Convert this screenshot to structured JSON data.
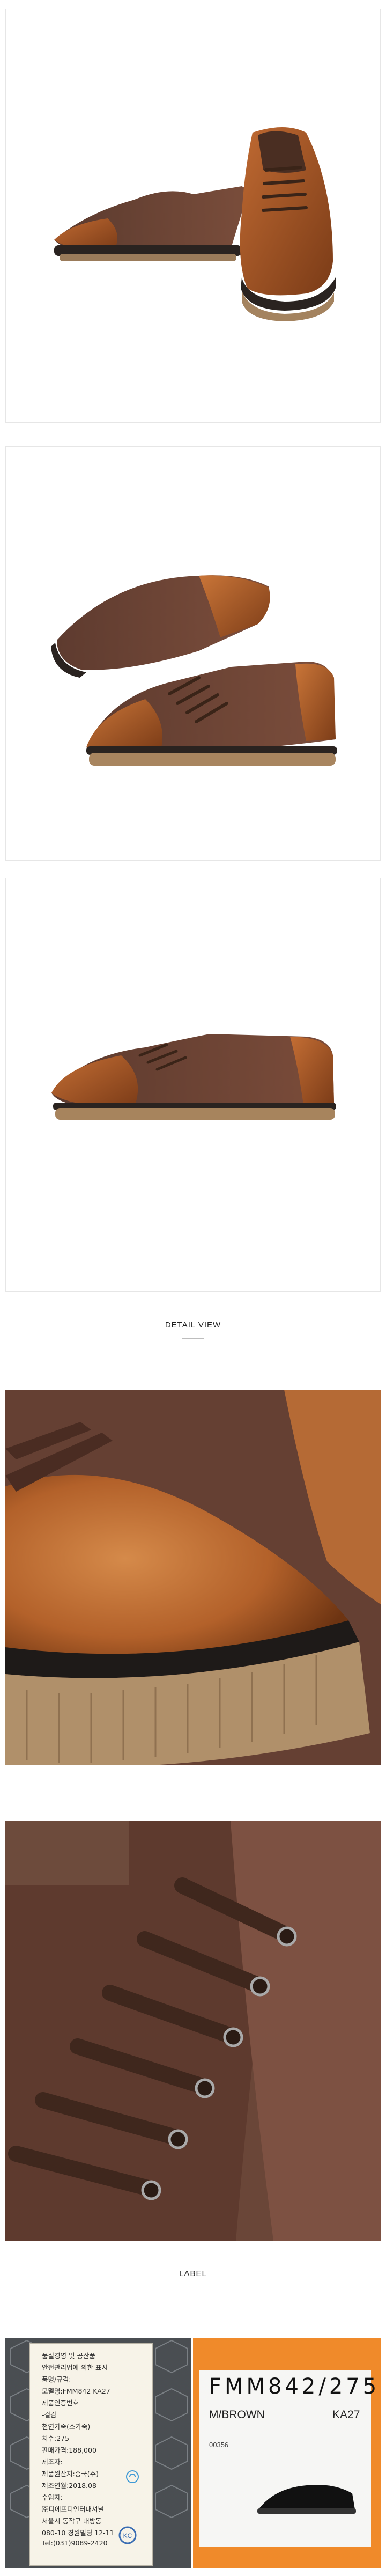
{
  "sections": {
    "detail_view": "DETAIL VIEW",
    "label": "LABEL"
  },
  "product_label": {
    "lines": [
      "품질경영 및 공산품",
      "안전관리법에 의한 표시",
      "품명/규격:",
      "모델명:FMM842 KA27",
      "제품인증번호",
      "-겉감",
      "    천연가죽(소가죽)",
      "치수:275",
      "판매가격:188,000",
      "제조자:",
      "제품원산지:중국(주)",
      "제조연월:2018.08",
      "수입자:",
      "㈜디에프디인터내셔널",
      "서울시 동작구 대방동",
      "080-10 경원빌딩 12-11",
      "Tel:(031)9089-2420"
    ]
  },
  "shoe_tag": {
    "code": "FMM842/275",
    "color": "M/BROWN",
    "model": "KA27",
    "small": "00356"
  }
}
